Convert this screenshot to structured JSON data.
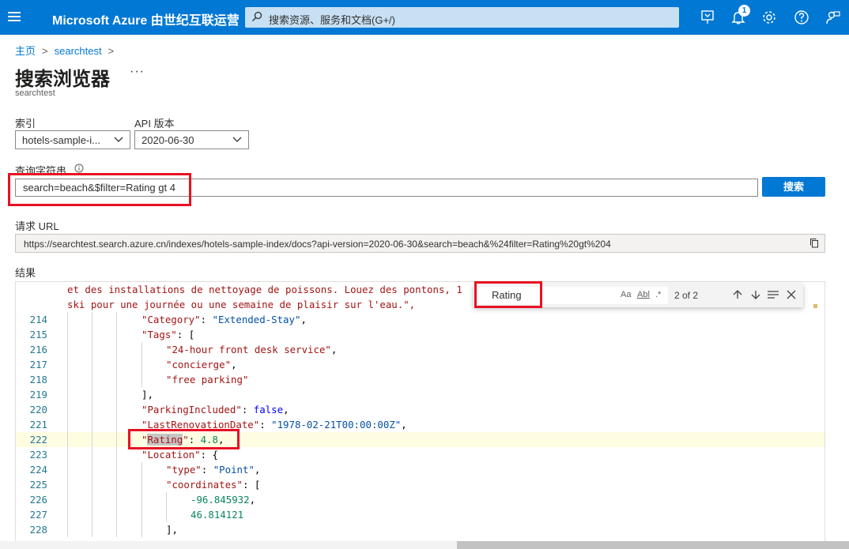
{
  "header": {
    "brand": "Microsoft Azure 由世纪互联运营",
    "search_placeholder": "搜索资源、服务和文档(G+/)",
    "notification_count": "1",
    "colors": {
      "bar": "#0078d4",
      "search_bg": "#c7e0f4"
    },
    "icons": [
      "menu-icon",
      "search-icon",
      "cloud-shell-icon",
      "bell-icon",
      "gear-icon",
      "help-icon",
      "feedback-icon"
    ]
  },
  "breadcrumb": {
    "home": "主页",
    "current": "searchtest",
    "separator": ">"
  },
  "page": {
    "title": "搜索浏览器",
    "more": "···",
    "subtitle": "searchtest"
  },
  "form": {
    "index_label": "索引",
    "index_value": "hotels-sample-i...",
    "api_label": "API 版本",
    "api_value": "2020-06-30",
    "query_label": "查询字符串",
    "query_value": "search=beach&$filter=Rating gt 4",
    "search_button": "搜索",
    "url_label": "请求 URL",
    "url_value": "https://searchtest.search.azure.cn/indexes/hotels-sample-index/docs?api-version=2020-06-30&search=beach&%24filter=Rating%20gt%204",
    "results_label": "结果"
  },
  "find_widget": {
    "value": "Rating",
    "match_case": "Aa",
    "whole_word": "Abl",
    "regex": ".*",
    "count": "2 of 2"
  },
  "editor": {
    "wrap1": "et des installations de nettoyage de poissons. Louez des pontons, 1",
    "wrap2": "ski pour une journée ou une semaine de plaisir sur l'eau.\",",
    "lines": [
      {
        "n": "214",
        "key": "\"Category\"",
        "val": "\"Extended-Stay\""
      },
      {
        "n": "215",
        "key": "\"Tags\"",
        "val": "["
      },
      {
        "n": "216",
        "val": "\"24-hour front desk service\""
      },
      {
        "n": "217",
        "val": "\"concierge\""
      },
      {
        "n": "218",
        "val": "\"free parking\""
      },
      {
        "n": "219",
        "val": "],"
      },
      {
        "n": "220",
        "key": "\"ParkingIncluded\"",
        "val": "false"
      },
      {
        "n": "221",
        "key": "\"LastRenovationDate\"",
        "val": "\"1978-02-21T00:00:00Z\""
      },
      {
        "n": "222",
        "key": "Rating",
        "val": "4.8"
      },
      {
        "n": "223",
        "key": "\"Location\"",
        "val": "{"
      },
      {
        "n": "224",
        "key": "\"type\"",
        "val": "\"Point\""
      },
      {
        "n": "225",
        "key": "\"coordinates\"",
        "val": "["
      },
      {
        "n": "226",
        "val": "-96.845932"
      },
      {
        "n": "227",
        "val": "46.814121"
      },
      {
        "n": "228",
        "val": "],"
      }
    ]
  }
}
